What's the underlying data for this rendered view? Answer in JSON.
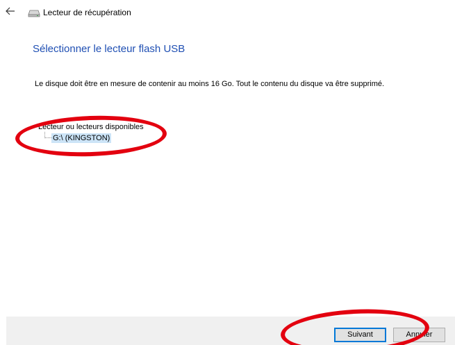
{
  "window": {
    "title": "Lecteur de récupération",
    "back_icon": "back-arrow-icon",
    "title_icon": "drive-icon"
  },
  "main": {
    "heading": "Sélectionner le lecteur flash USB",
    "description": "Le disque doit être en mesure de contenir au moins 16 Go. Tout le contenu du disque va être supprimé.",
    "drives_label": "Lecteur ou lecteurs disponibles",
    "drives": [
      {
        "label": "G:\\ (KINGSTON)",
        "selected": true
      }
    ]
  },
  "footer": {
    "next_label": "Suivant",
    "cancel_label": "Annuler"
  },
  "colors": {
    "heading": "#1f4fb3",
    "selection": "#cce4f7",
    "annotation": "#e3000f",
    "footer_bg": "#f0f0f0",
    "button_focus": "#0078d7"
  }
}
